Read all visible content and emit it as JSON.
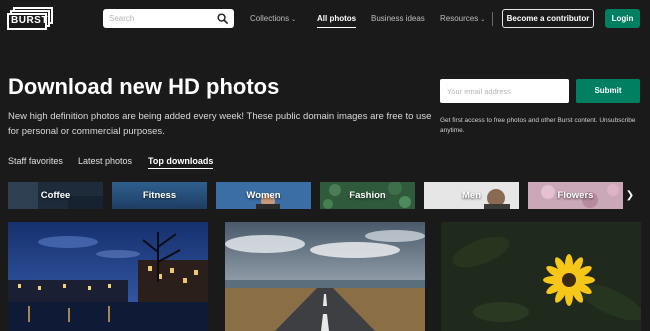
{
  "header": {
    "logo_text": "BURST",
    "search_placeholder": "Search",
    "nav": [
      {
        "label": "Collections",
        "has_caret": true
      },
      {
        "label": "All photos",
        "active": true
      },
      {
        "label": "Business ideas"
      },
      {
        "label": "Resources",
        "has_caret": true
      }
    ],
    "contributor_label": "Become a contributor",
    "login_label": "Login"
  },
  "hero": {
    "title": "Download new HD photos",
    "subtitle": "New high definition photos are being added every week! These public domain images are free to use for personal or commercial purposes.",
    "email_placeholder": "Your email address",
    "submit_label": "Submit",
    "email_note": "Get first access to free photos and other Burst content. Unsubscribe anytime."
  },
  "tabs": [
    {
      "label": "Staff favorites"
    },
    {
      "label": "Latest photos"
    },
    {
      "label": "Top downloads",
      "active": true
    }
  ],
  "categories": [
    {
      "label": "Coffee"
    },
    {
      "label": "Fitness"
    },
    {
      "label": "Women"
    },
    {
      "label": "Fashion"
    },
    {
      "label": "Men"
    },
    {
      "label": "Flowers"
    }
  ],
  "photos": [
    {
      "subject": "city canal at night"
    },
    {
      "subject": "open road under cloudy sky"
    },
    {
      "subject": "yellow flower on dark leaves"
    }
  ],
  "colors": {
    "background": "#1a1a1a",
    "accent_green": "#008060",
    "text_muted": "#bdbdbd"
  }
}
